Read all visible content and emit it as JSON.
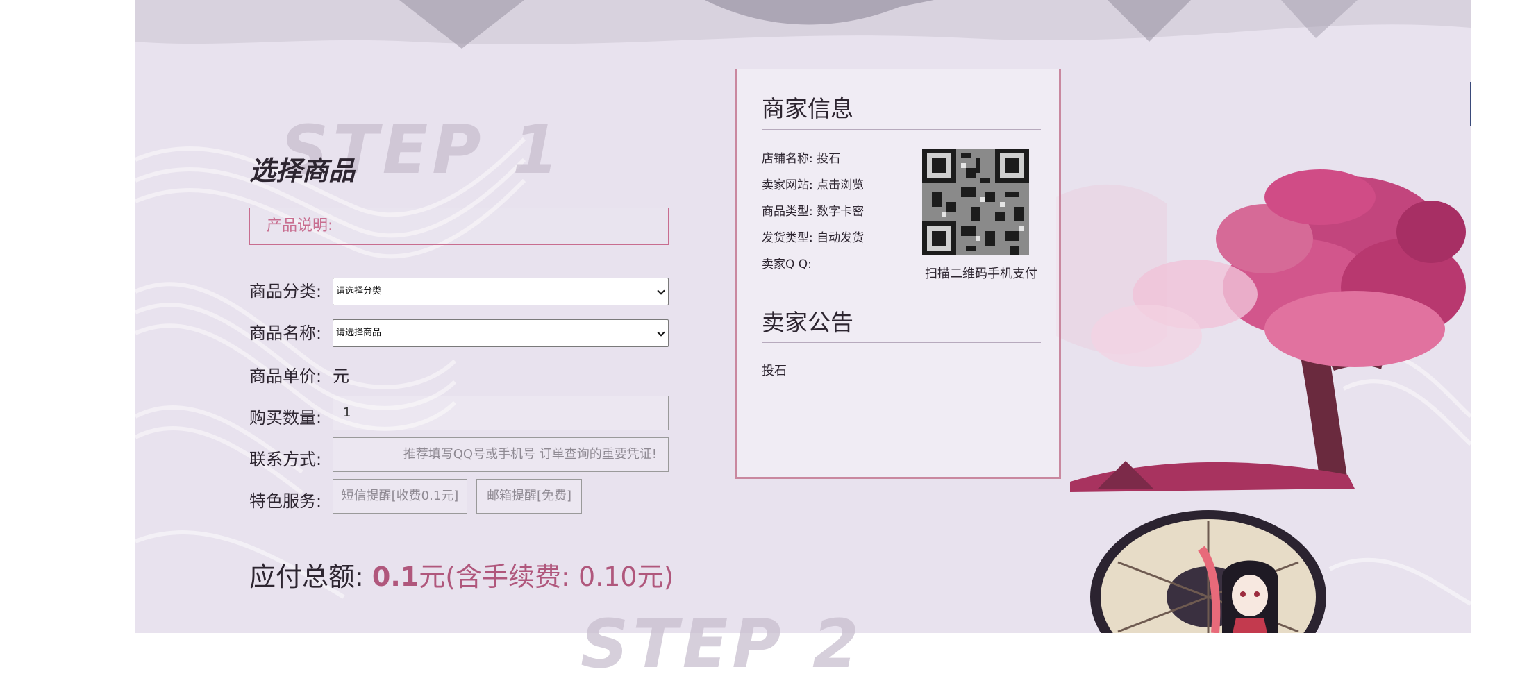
{
  "step1": {
    "watermark": "STEP  1",
    "title": "选择商品",
    "description_label": "产品说明:",
    "form": {
      "category_label": "商品分类:",
      "category_selected": "请选择分类",
      "product_label": "商品名称:",
      "product_selected": "请选择商品",
      "price_label": "商品单价:",
      "price_unit": "元",
      "quantity_label": "购买数量:",
      "quantity_value": "1",
      "contact_label": "联系方式:",
      "contact_placeholder": "推荐填写QQ号或手机号 订单查询的重要凭证!",
      "service_label": "特色服务:",
      "sms_button": "短信提醒[收费0.1元]",
      "email_button": "邮箱提醒[免费]"
    },
    "total": {
      "label": "应付总额:",
      "amount": "0.1",
      "suffix": "元(含手续费: 0.10元)"
    }
  },
  "merchant": {
    "heading": "商家信息",
    "shop_name": "店铺名称: 投石",
    "website": "卖家网站: 点击浏览",
    "product_type": "商品类型:  数字卡密",
    "delivery_type": "发货类型:  自动发货",
    "seller_qq": "卖家Q Q:",
    "qr_caption": "扫描二维码手机支付"
  },
  "notice": {
    "heading": "卖家公告",
    "text": "投石"
  },
  "step2": {
    "watermark": "STEP  2"
  },
  "colors": {
    "accent": "#b0577c",
    "border_pink": "#c86d8f",
    "background": "#e8e2ee"
  }
}
